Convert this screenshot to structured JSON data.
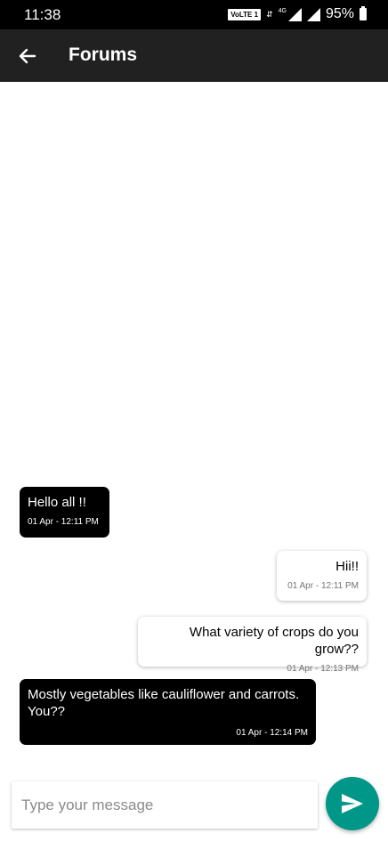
{
  "status_bar": {
    "time": "11:38",
    "volte": "VoLTE 1",
    "network": "4G",
    "battery": "95%",
    "icons": [
      "volte-icon",
      "data-arrows-icon",
      "signal-icon",
      "signal-icon",
      "battery-icon"
    ]
  },
  "app_bar": {
    "title": "Forums",
    "back_icon": "arrow-left-icon"
  },
  "messages": [
    {
      "text": "Hello all !!",
      "time": "01 Apr - 12:11 PM",
      "sender": "other"
    },
    {
      "text": "Hii!!",
      "time": "01 Apr - 12:11 PM",
      "sender": "me"
    },
    {
      "text": "What variety of crops do you grow??",
      "time": "01 Apr - 12:13 PM",
      "sender": "me"
    },
    {
      "text": "Mostly vegetables like cauliflower and carrots. You??",
      "time": "01 Apr - 12:14 PM",
      "sender": "other"
    }
  ],
  "composer": {
    "placeholder": "Type your message",
    "value": "",
    "send_icon": "send-icon"
  },
  "colors": {
    "status_bar": "#000000",
    "app_bar": "#212121",
    "incoming_bubble": "#000000",
    "outgoing_bubble": "#ffffff",
    "send_button": "#009688"
  }
}
